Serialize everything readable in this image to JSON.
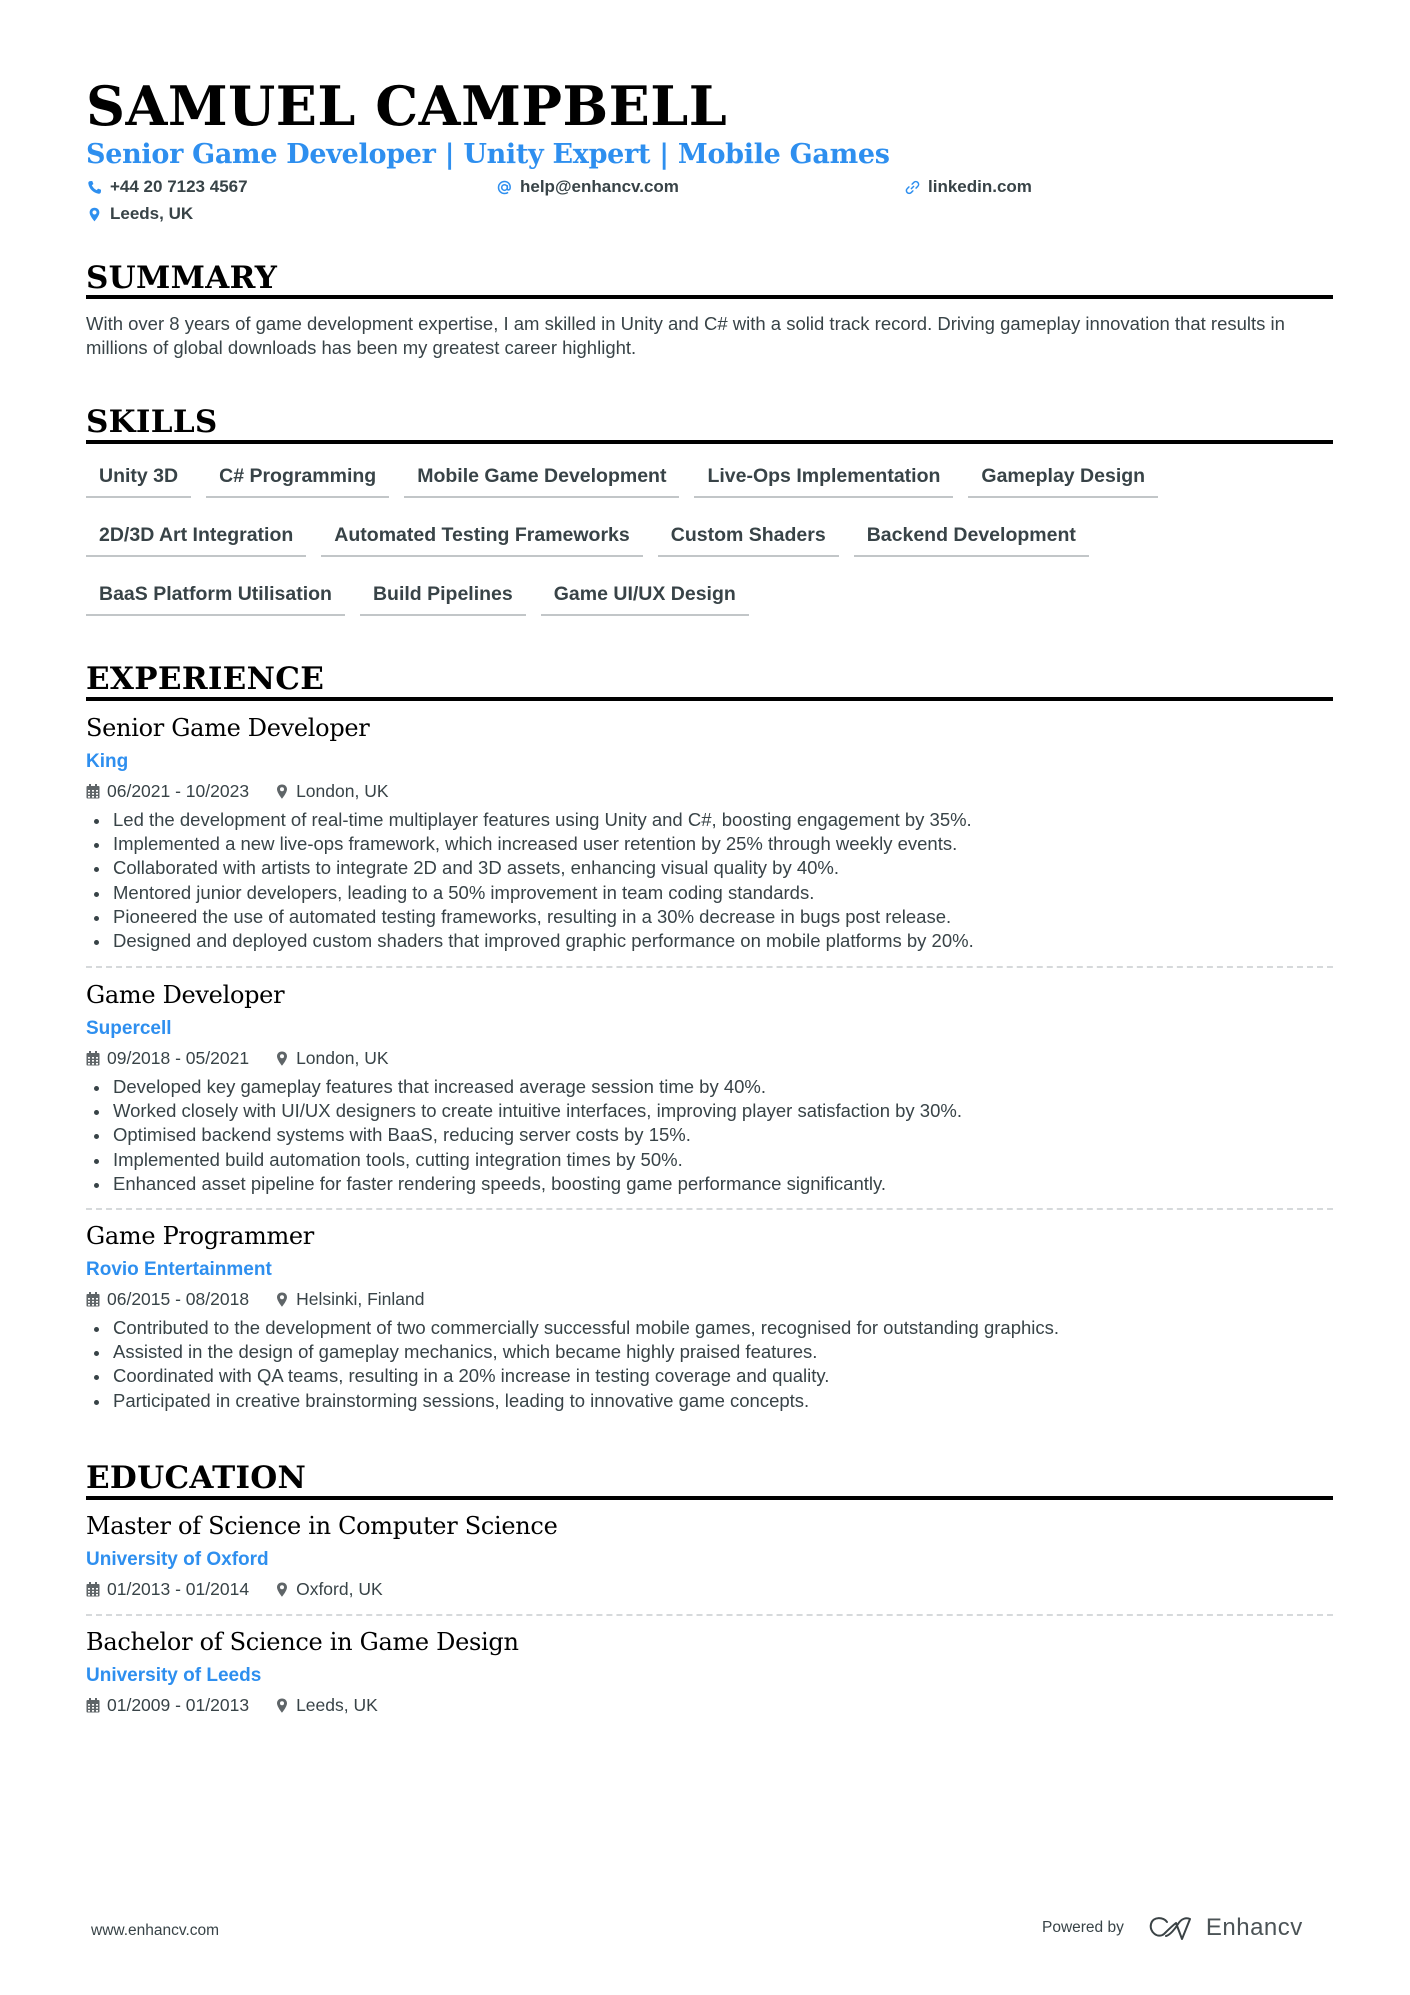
{
  "header": {
    "name": "SAMUEL CAMPBELL",
    "title": "Senior Game Developer | Unity Expert | Mobile Games",
    "contacts": {
      "phone": {
        "icon": "phone-icon",
        "text": "+44 20 7123 4567"
      },
      "email": {
        "icon": "at-icon",
        "text": "help@enhancv.com"
      },
      "link": {
        "icon": "link-icon",
        "text": "linkedin.com"
      },
      "location": {
        "icon": "location-pin-icon",
        "text": "Leeds, UK"
      }
    }
  },
  "accent_color": "#2e8fef",
  "summary": {
    "heading": "SUMMARY",
    "text": "With over 8 years of game development expertise, I am skilled in Unity and C# with a solid track record. Driving gameplay innovation that results in millions of global downloads has been my greatest career highlight."
  },
  "skills": {
    "heading": "SKILLS",
    "items": [
      "Unity 3D",
      "C# Programming",
      "Mobile Game Development",
      "Live-Ops Implementation",
      "Gameplay Design",
      "2D/3D Art Integration",
      "Automated Testing Frameworks",
      "Custom Shaders",
      "Backend Development",
      "BaaS Platform Utilisation",
      "Build Pipelines",
      "Game UI/UX Design"
    ]
  },
  "experience": {
    "heading": "EXPERIENCE",
    "items": [
      {
        "role": "Senior Game Developer",
        "company": "King",
        "dates": "06/2021 - 10/2023",
        "location": "London, UK",
        "bullets": [
          "Led the development of real-time multiplayer features using Unity and C#, boosting engagement by 35%.",
          "Implemented a new live-ops framework, which increased user retention by 25% through weekly events.",
          "Collaborated with artists to integrate 2D and 3D assets, enhancing visual quality by 40%.",
          "Mentored junior developers, leading to a 50% improvement in team coding standards.",
          "Pioneered the use of automated testing frameworks, resulting in a 30% decrease in bugs post release.",
          "Designed and deployed custom shaders that improved graphic performance on mobile platforms by 20%."
        ]
      },
      {
        "role": "Game Developer",
        "company": "Supercell",
        "dates": "09/2018 - 05/2021",
        "location": "London, UK",
        "bullets": [
          "Developed key gameplay features that increased average session time by 40%.",
          "Worked closely with UI/UX designers to create intuitive interfaces, improving player satisfaction by 30%.",
          "Optimised backend systems with BaaS, reducing server costs by 15%.",
          "Implemented build automation tools, cutting integration times by 50%.",
          "Enhanced asset pipeline for faster rendering speeds, boosting game performance significantly."
        ]
      },
      {
        "role": "Game Programmer",
        "company": "Rovio Entertainment",
        "dates": "06/2015 - 08/2018",
        "location": "Helsinki, Finland",
        "bullets": [
          "Contributed to the development of two commercially successful mobile games, recognised for outstanding graphics.",
          "Assisted in the design of gameplay mechanics, which became highly praised features.",
          "Coordinated with QA teams, resulting in a 20% increase in testing coverage and quality.",
          "Participated in creative brainstorming sessions, leading to innovative game concepts."
        ]
      }
    ]
  },
  "education": {
    "heading": "EDUCATION",
    "items": [
      {
        "degree": "Master of Science in Computer Science",
        "school": "University of Oxford",
        "dates": "01/2013 - 01/2014",
        "location": "Oxford, UK"
      },
      {
        "degree": "Bachelor of Science in Game Design",
        "school": "University of Leeds",
        "dates": "01/2009 - 01/2013",
        "location": "Leeds, UK"
      }
    ]
  },
  "footer": {
    "website": "www.enhancv.com",
    "powered_by": "Powered by",
    "brand": "Enhancv"
  }
}
